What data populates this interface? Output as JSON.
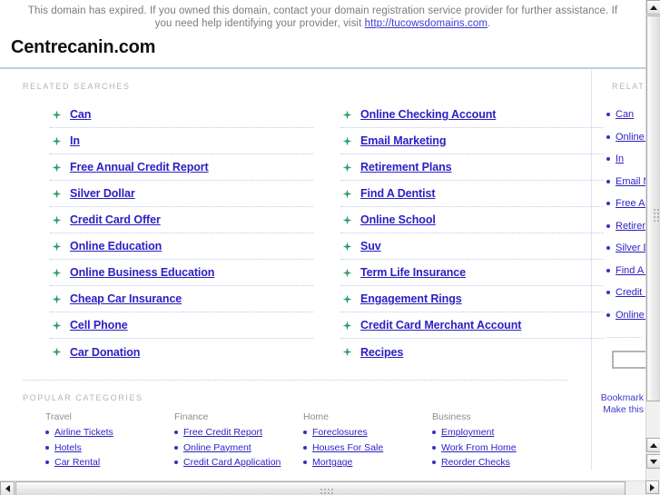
{
  "banner": {
    "text_before_link": "This domain has expired. If you owned this domain, contact your domain registration service provider for further assistance. If you need help identifying your provider, visit ",
    "link_text": "http://tucowsdomains.com",
    "text_after_link": "."
  },
  "header": {
    "site_title": "Centrecanin.com"
  },
  "main": {
    "related_searches_label": "RELATED SEARCHES",
    "related_searches_left": [
      "Can",
      "In",
      "Free Annual Credit Report",
      "Silver Dollar",
      "Credit Card Offer",
      "Online Education",
      "Online Business Education",
      "Cheap Car Insurance",
      "Cell Phone",
      "Car Donation"
    ],
    "related_searches_right": [
      "Online Checking Account",
      "Email Marketing",
      "Retirement Plans",
      "Find A Dentist",
      "Online School",
      "Suv",
      "Term Life Insurance",
      "Engagement Rings",
      "Credit Card Merchant Account",
      "Recipes"
    ],
    "popular_categories_label": "POPULAR CATEGORIES",
    "categories": [
      {
        "title": "Travel",
        "links": [
          "Airline Tickets",
          "Hotels",
          "Car Rental"
        ]
      },
      {
        "title": "Finance",
        "links": [
          "Free Credit Report",
          "Online Payment",
          "Credit Card Application"
        ]
      },
      {
        "title": "Home",
        "links": [
          "Foreclosures",
          "Houses For Sale",
          "Mortgage"
        ]
      },
      {
        "title": "Business",
        "links": [
          "Employment",
          "Work From Home",
          "Reorder Checks"
        ]
      }
    ]
  },
  "sidebar": {
    "related_label": "RELATED",
    "items": [
      "Can",
      "Online Checking Account",
      "In",
      "Email Marketing",
      "Free Annual Credit Report",
      "Retirement Plans",
      "Silver Dollar",
      "Find A Dentist",
      "Credit Card Offer",
      "Online School"
    ],
    "search_value": "",
    "search_placeholder": "",
    "footer_line1": "Bookmark",
    "footer_line2": "Make this"
  },
  "colors": {
    "link": "#2b1fc4",
    "muted_label": "#b4b4b4",
    "rule": "#b9cdea",
    "star": "#2e9e6b"
  }
}
